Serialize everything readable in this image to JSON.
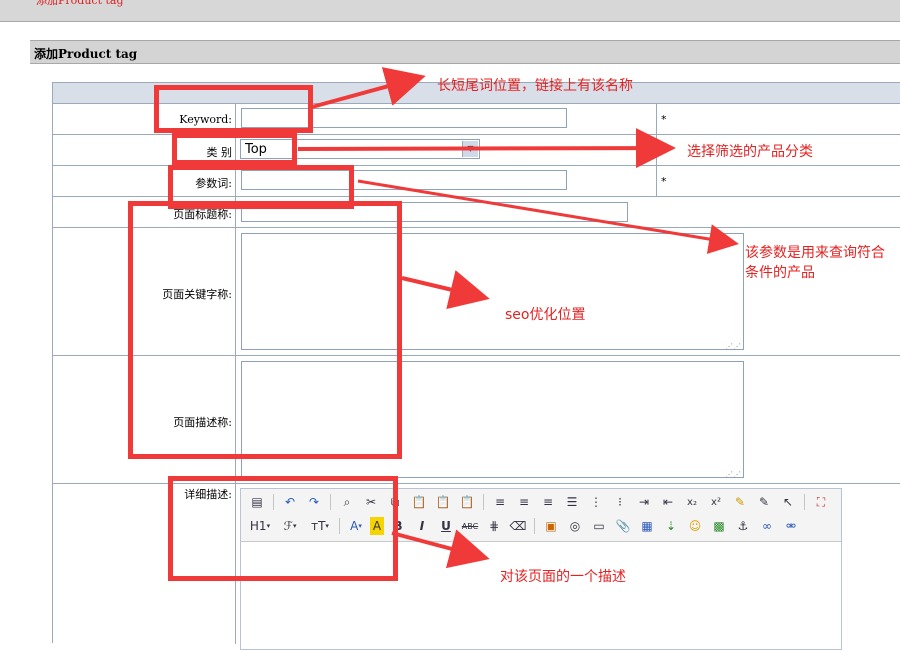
{
  "page": {
    "breadcrumb": "添加Product tag",
    "title": "添加Product tag"
  },
  "form": {
    "keyword_label": "Keyword:",
    "keyword_value": "",
    "required_mark": "*",
    "category_label": "类 别",
    "category_value": "Top",
    "param_label": "参数词:",
    "param_value": "",
    "page_title_label": "页面标题称:",
    "page_keywords_label": "页面关键字称:",
    "page_desc_label": "页面描述称:",
    "detail_label": "详细描述:"
  },
  "editor": {
    "toolbar_row1": [
      "paste-icon",
      "undo-icon",
      "redo-icon",
      "preview-icon",
      "cut-icon",
      "copy-icon",
      "paste-text-icon",
      "paste-word-icon",
      "align-left-icon",
      "align-center-icon",
      "align-right-icon",
      "align-justify-icon",
      "ordered-list-icon",
      "unordered-list-icon",
      "indent-icon",
      "outdent-icon",
      "subscript-icon",
      "superscript-icon",
      "clear-format-icon",
      "select-all-icon",
      "select-icon",
      "fullscreen-icon"
    ],
    "toolbar_row2_text": {
      "heading": "H1",
      "font": "ℱ",
      "size": "тT",
      "color": "A",
      "highlight": "A",
      "bold": "B",
      "italic": "I",
      "underline": "U",
      "strike": "ABC"
    }
  },
  "annotations": {
    "keyword_note": "长短尾词位置，链接上有该名称",
    "category_note": "选择筛选的产品分类",
    "param_note": "该参数是用来查询符合条件的产品",
    "seo_note": "seo优化位置",
    "detail_note": "对该页面的一个描述"
  },
  "colors": {
    "annotation": "#f03a3a",
    "grid": "#99aabb",
    "header_bg": "#d4d4d4"
  }
}
